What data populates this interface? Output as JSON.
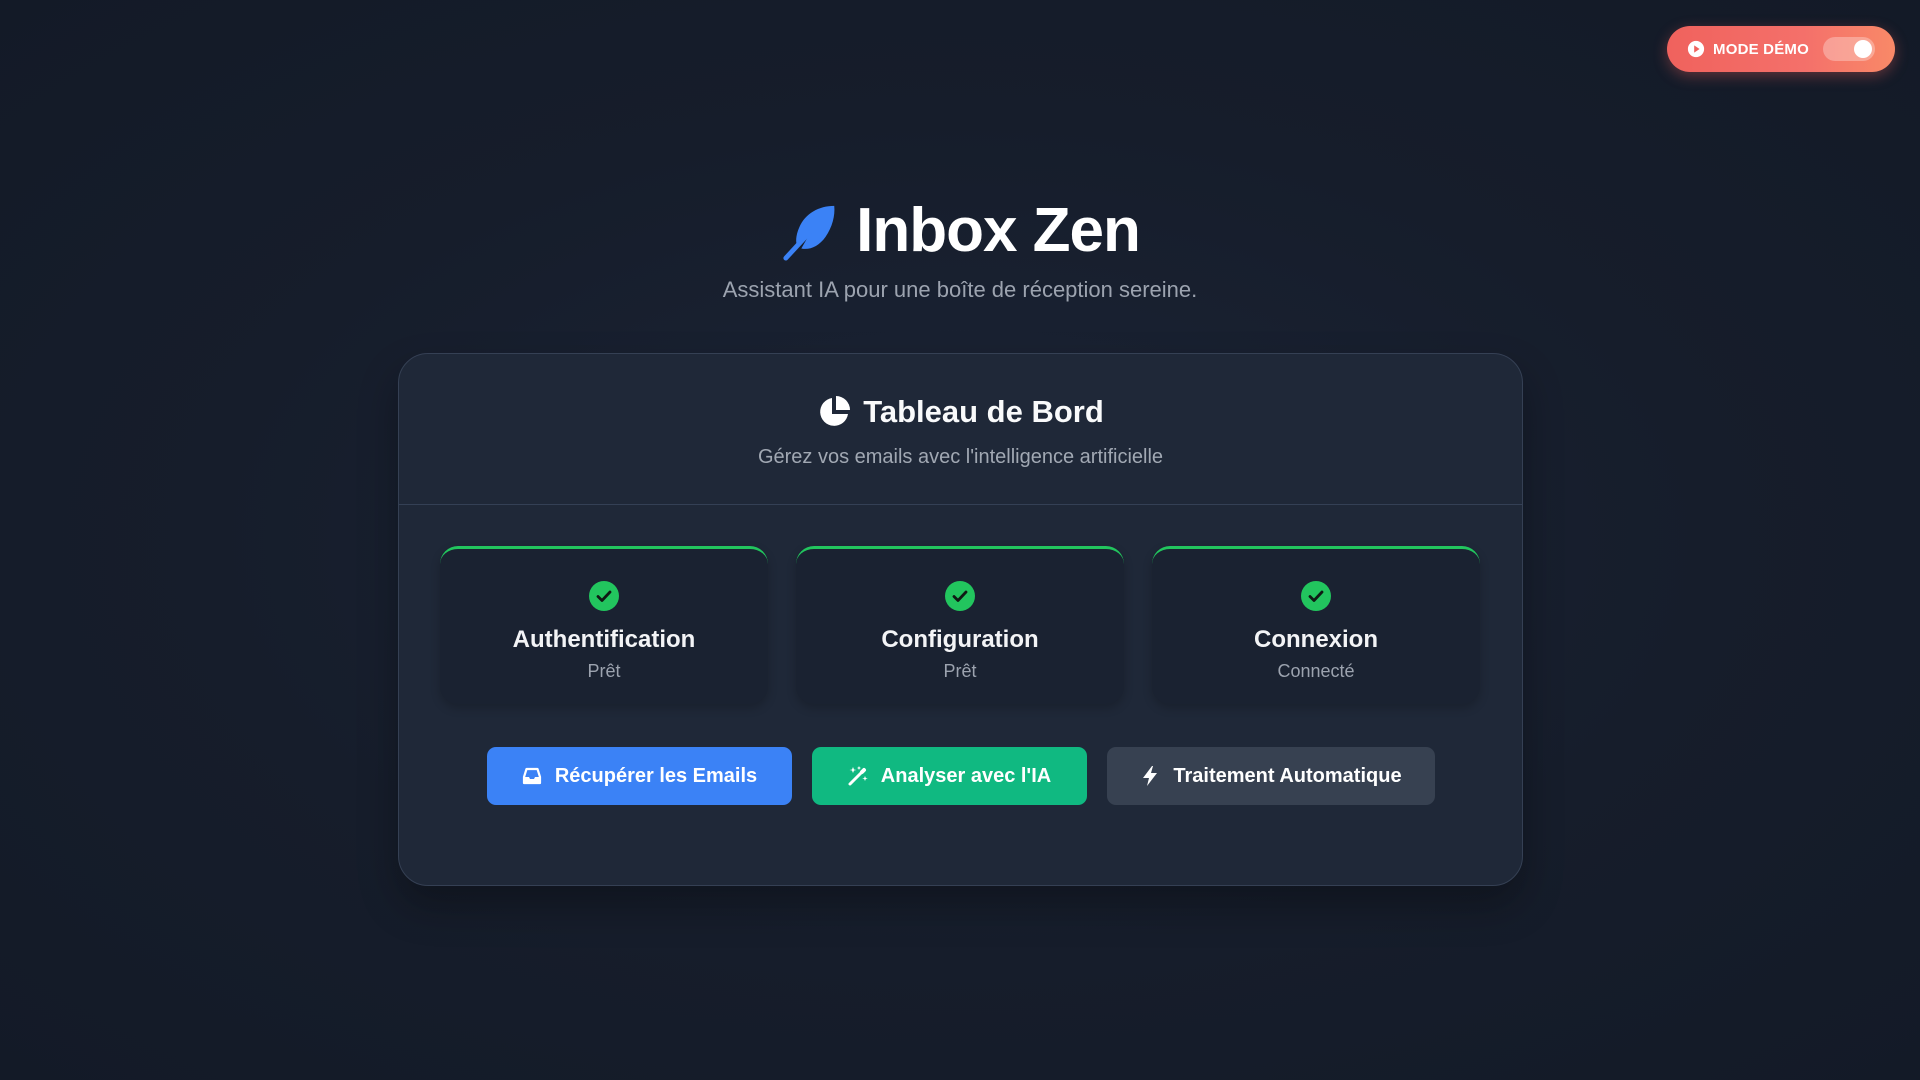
{
  "demo_mode": {
    "label": "MODE DÉMO",
    "enabled": true,
    "icon": "play-circle-icon",
    "accent": "#f0625d"
  },
  "header": {
    "title": "Inbox Zen",
    "tagline": "Assistant IA pour une boîte de réception sereine.",
    "logo_icon": "feather-icon",
    "logo_color": "#3b82f6"
  },
  "dashboard": {
    "title": "Tableau de Bord",
    "subtitle": "Gérez vos emails avec l'intelligence artificielle",
    "title_icon": "pie-chart-icon"
  },
  "status_cards": [
    {
      "name": "Authentification",
      "state": "Prêt",
      "icon": "check-circle-icon",
      "color": "#22c55e"
    },
    {
      "name": "Configuration",
      "state": "Prêt",
      "icon": "check-circle-icon",
      "color": "#22c55e"
    },
    {
      "name": "Connexion",
      "state": "Connecté",
      "icon": "check-circle-icon",
      "color": "#22c55e"
    }
  ],
  "actions": {
    "fetch": {
      "label": "Récupérer les Emails",
      "icon": "inbox-icon",
      "color": "#3b82f6"
    },
    "analyze": {
      "label": "Analyser avec l'IA",
      "icon": "magic-wand-icon",
      "color": "#10b981"
    },
    "auto": {
      "label": "Traitement Automatique",
      "icon": "bolt-icon",
      "color": "#374151"
    }
  }
}
